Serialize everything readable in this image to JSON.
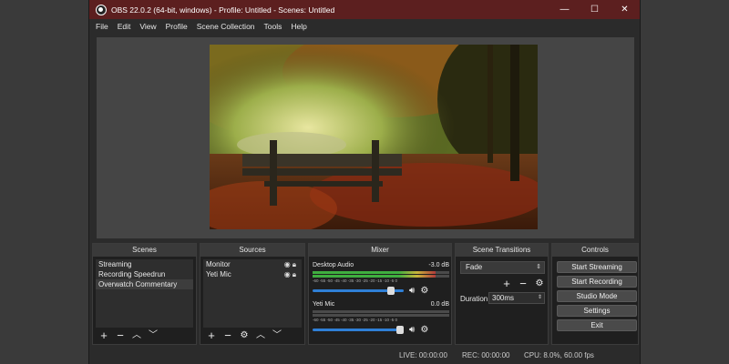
{
  "window": {
    "title": "OBS 22.0.2 (64-bit, windows) - Profile: Untitled - Scenes: Untitled",
    "controls": [
      "—",
      "☐",
      "✕"
    ]
  },
  "menu": [
    "File",
    "Edit",
    "View",
    "Profile",
    "Scene Collection",
    "Tools",
    "Help"
  ],
  "docks": {
    "scenes": {
      "title": "Scenes",
      "items": [
        "Streaming",
        "Recording Speedrun",
        "Overwatch Commentary"
      ],
      "selected_index": 2
    },
    "sources": {
      "title": "Sources",
      "items": [
        "Monitor",
        "Yeti Mic"
      ]
    },
    "mixer": {
      "title": "Mixer",
      "channels": [
        {
          "name": "Desktop Audio",
          "level": "-3.0 dB",
          "meter_fraction": 0.9,
          "volume_fraction": 0.9
        },
        {
          "name": "Yeti Mic",
          "level": "0.0 dB",
          "meter_fraction": 0.0,
          "volume_fraction": 1.0
        }
      ],
      "ticks": "-60 -55 -50 -45 -40 -35 -30 -25 -20 -15 -10 -5 0"
    },
    "transitions": {
      "title": "Scene Transitions",
      "selected": "Fade",
      "duration_label": "Duration",
      "duration_value": "300ms"
    },
    "controls": {
      "title": "Controls",
      "buttons": [
        "Start Streaming",
        "Start Recording",
        "Studio Mode",
        "Settings",
        "Exit"
      ]
    }
  },
  "status": {
    "live": "LIVE: 00:00:00",
    "rec": "REC: 00:00:00",
    "cpu": "CPU: 8.0%, 60.00 fps"
  },
  "colors": {
    "titlebar": "#5c1f1f",
    "panel": "#2b2b2b",
    "accent": "#2f7fd6"
  }
}
